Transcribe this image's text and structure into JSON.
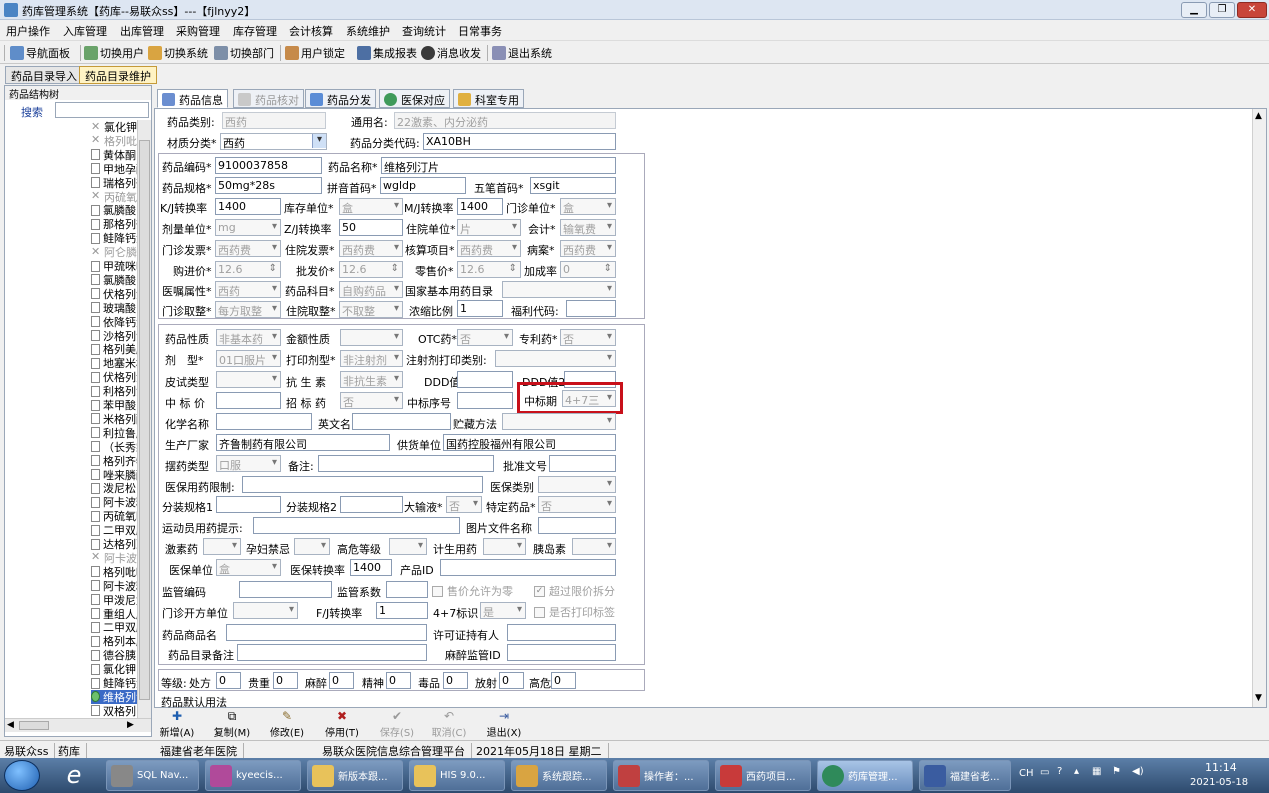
{
  "window": {
    "title": "药库管理系统【药库--易联众ss】---【fjlnyy2】"
  },
  "menu": [
    "用户操作",
    "入库管理",
    "出库管理",
    "采购管理",
    "库存管理",
    "会计核算",
    "系统维护",
    "查询统计",
    "日常事务"
  ],
  "toolbar": [
    "导航面板",
    "切换用户",
    "切换系统",
    "切换部门",
    "用户锁定",
    "集成报表",
    "消息收发",
    "退出系统"
  ],
  "top_tabs": [
    "药品目录导入",
    "药品目录维护"
  ],
  "tree": {
    "title": "药品结构树",
    "search_label": "搜索",
    "nodes": [
      {
        "label": "氯化钾",
        "grey": false,
        "x": true
      },
      {
        "label": "格列吡嗪",
        "grey": true,
        "x": true
      },
      {
        "label": "黄体酮",
        "grey": false,
        "x": false
      },
      {
        "label": "甲地孕酮",
        "grey": false,
        "x": false
      },
      {
        "label": "瑞格列奈",
        "grey": false,
        "x": false
      },
      {
        "label": "丙硫氧嘧啶",
        "grey": true,
        "x": true
      },
      {
        "label": "氯膦酸",
        "grey": false,
        "x": false
      },
      {
        "label": "那格列奈",
        "grey": false,
        "x": false
      },
      {
        "label": "鲑降钙素",
        "grey": false,
        "x": false
      },
      {
        "label": "阿仑膦酸",
        "grey": true,
        "x": true
      },
      {
        "label": "甲巯咪唑",
        "grey": false,
        "x": false
      },
      {
        "label": "氯膦酸",
        "grey": false,
        "x": false
      },
      {
        "label": "伏格列波糖",
        "grey": false,
        "x": false
      },
      {
        "label": "玻璃酸",
        "grey": false,
        "x": false
      },
      {
        "label": "依降钙素",
        "grey": false,
        "x": false
      },
      {
        "label": "沙格列汀",
        "grey": false,
        "x": false
      },
      {
        "label": "格列美脲",
        "grey": false,
        "x": false
      },
      {
        "label": "地塞米松",
        "grey": false,
        "x": false
      },
      {
        "label": "伏格列波糖",
        "grey": false,
        "x": false
      },
      {
        "label": "利格列汀",
        "grey": false,
        "x": false
      },
      {
        "label": "苯甲酸",
        "grey": false,
        "x": false
      },
      {
        "label": "米格列醇",
        "grey": false,
        "x": false
      },
      {
        "label": "利拉鲁肽",
        "grey": false,
        "x": false
      },
      {
        "label": "（长秀霖）",
        "grey": false,
        "x": false
      },
      {
        "label": "格列齐特",
        "grey": false,
        "x": false
      },
      {
        "label": "唑来膦酸",
        "grey": false,
        "x": false
      },
      {
        "label": "泼尼松",
        "grey": false,
        "x": false
      },
      {
        "label": "阿卡波糖",
        "grey": false,
        "x": false
      },
      {
        "label": "丙硫氧嘧啶",
        "grey": false,
        "x": false
      },
      {
        "label": "二甲双胍",
        "grey": false,
        "x": false
      },
      {
        "label": "达格列净",
        "grey": false,
        "x": false
      },
      {
        "label": "阿卡波糖",
        "grey": true,
        "x": true
      },
      {
        "label": "格列吡嗪",
        "grey": false,
        "x": false
      },
      {
        "label": "阿卡波糖",
        "grey": false,
        "x": false
      },
      {
        "label": "甲泼尼龙",
        "grey": false,
        "x": false
      },
      {
        "label": "重组人胰岛素",
        "grey": false,
        "x": false
      },
      {
        "label": "二甲双胍",
        "grey": false,
        "x": false
      },
      {
        "label": "格列本脲",
        "grey": false,
        "x": false
      },
      {
        "label": "德谷胰岛素",
        "grey": false,
        "x": false
      },
      {
        "label": "氯化钾",
        "grey": false,
        "x": false
      },
      {
        "label": "鲑降钙素",
        "grey": false,
        "x": false
      },
      {
        "label": "维格列汀",
        "grey": false,
        "x": false,
        "selected": true
      },
      {
        "label": "双格列",
        "grey": false,
        "x": false
      }
    ]
  },
  "tabs": [
    {
      "label": "药品信息",
      "active": true,
      "disabled": false
    },
    {
      "label": "药品核对",
      "active": false,
      "disabled": true
    },
    {
      "label": "药品分发",
      "active": false,
      "disabled": false
    },
    {
      "label": "医保对应",
      "active": false,
      "disabled": false
    },
    {
      "label": "科室专用",
      "active": false,
      "disabled": false
    }
  ],
  "form": {
    "l_category": "药品类别:",
    "category": "西药",
    "l_generic": "通用名:",
    "generic": "22激素、内分泌药",
    "l_material": "材质分类*",
    "material": "西药",
    "l_classcode": "药品分类代码:",
    "classcode": "XA10BH",
    "l_code": "药品编码*",
    "code": "9100037858",
    "l_name": "药品名称*",
    "name": "维格列汀片",
    "l_spec": "药品规格*",
    "spec": "50mg*28s",
    "l_pinyin": "拼音首码*",
    "pinyin": "wgldp",
    "l_wubi": "五笔首码*",
    "wubi": "xsgit",
    "l_kj": "K/J转换率",
    "kj": "1400",
    "l_stockunit": "库存单位*",
    "stockunit": "盒",
    "l_mj": "M/J转换率",
    "mj": "1400",
    "l_opunit": "门诊单位*",
    "opunit": "盒",
    "l_doseunit": "剂量单位*",
    "doseunit": "mg",
    "l_zj": "Z/J转换率",
    "zj": "50",
    "l_inunit": "住院单位*",
    "inunit": "片",
    "l_acct": "会计*",
    "acct": "输氧费",
    "l_opinv": "门诊发票*",
    "opinv": "西药费",
    "l_ininv": "住院发票*",
    "ininv": "西药费",
    "l_audit": "核算项目*",
    "audit": "西药费",
    "l_case": "病案*",
    "case": "西药费",
    "l_buy": "购进价*",
    "buy": "12.6",
    "l_whole": "批发价*",
    "whole": "12.6",
    "l_retail": "零售价*",
    "retail": "12.6",
    "l_markup": "加成率",
    "markup": "0",
    "l_orderattr": "医嘱属性*",
    "orderattr": "西药",
    "l_subject": "药品科目*",
    "subject": "自购药品",
    "l_essential": "国家基本用药目录",
    "essential": "",
    "l_opround": "门诊取整*",
    "opround": "每方取整",
    "l_inround": "住院取整*",
    "inround": "不取整",
    "l_ratio": "浓缩比例",
    "ratio": "1",
    "l_fukang": "福利代码:",
    "fukang": "",
    "l_nature": "药品性质",
    "nature": "非基本药",
    "l_amount": "金额性质",
    "amount": "",
    "l_otc": "OTC药*",
    "otc": "否",
    "l_patent": "专利药*",
    "patent": "否",
    "l_form": "剂　型*",
    "form_v": "01口服片",
    "l_printform": "打印剂型*",
    "printform": "非注射剂",
    "l_injprint": "注射剂打印类别:",
    "injprint": "",
    "l_skintest": "皮试类型",
    "skintest": "",
    "l_antibiotic": "抗 生 素",
    "antibiotic": "非抗生素",
    "l_ddd": "DDD值",
    "ddd": "",
    "l_ddd2": "DDD值2",
    "ddd2": "",
    "l_bidprice": "中 标 价",
    "bidprice": "",
    "l_bidmed": "招 标 药",
    "bidmed": "否",
    "l_bidno": "中标序号",
    "bidno": "",
    "l_bidperiod": "中标期",
    "bidperiod": "4+7三",
    "l_chem": "化学名称",
    "chem": "",
    "l_en": "英文名",
    "en": "",
    "l_storage": "贮藏方法",
    "storage": "",
    "l_maker": "生产厂家",
    "maker": "齐鲁制药有限公司",
    "l_supplier": "供货单位",
    "supplier": "国药控股福州有限公司",
    "l_display": "摆药类型",
    "display": "口服",
    "l_note": "备注:",
    "note": "",
    "l_approval": "批准文号",
    "approval": "",
    "l_insurlimit": "医保用药限制:",
    "insurlimit": "",
    "l_insurcat": "医保类别",
    "insurcat": "",
    "l_pack1": "分装规格1",
    "pack1": "",
    "l_pack2": "分装规格2",
    "pack2": "",
    "l_infusion": "大输液*",
    "infusion": "否",
    "l_special": "特定药品*",
    "special": "否",
    "l_athlete": "运动员用药提示:",
    "athlete": "",
    "l_image": "图片文件名称",
    "image": "",
    "l_hormone": "激素药",
    "hormone": "",
    "l_preg": "孕妇禁忌",
    "preg": "",
    "l_alert": "高危等级",
    "alert": "",
    "l_family": "计生用药",
    "family": "",
    "l_insulin": "胰岛素",
    "insulin": "",
    "l_insunit": "医保单位",
    "insunit": "盒",
    "l_insrate": "医保转换率",
    "insrate": "1400",
    "l_pid": "产品ID",
    "pid": "",
    "l_supcode": "监管编码",
    "supcode": "",
    "l_supcoef": "监管系数",
    "supcoef": "",
    "c_allowzero": "售价允许为零",
    "c_overlimit": "超过限价拆分",
    "l_opunit2": "门诊开方单位",
    "opunit2": "",
    "l_fj": "F/J转换率",
    "fj": "1",
    "l_flag47": "4+7标识",
    "flag47": "是",
    "c_printlabel": "是否打印标签",
    "l_trade": "药品商品名",
    "trade": "",
    "l_license": "许可证持有人",
    "license": "",
    "l_catnote": "药品目录备注",
    "catnote": "",
    "l_narcid": "麻醉监管ID",
    "narcid": ""
  },
  "levels": {
    "label": "等级:",
    "items": [
      {
        "label": "处方",
        "value": "0"
      },
      {
        "label": "贵重",
        "value": "0"
      },
      {
        "label": "麻醉",
        "value": "0"
      },
      {
        "label": "精神",
        "value": "0"
      },
      {
        "label": "毒品",
        "value": "0"
      },
      {
        "label": "放射",
        "value": "0"
      },
      {
        "label": "高危",
        "value": "0"
      }
    ],
    "default_usage": "药品默认用法"
  },
  "bottom_buttons": [
    {
      "label": "新增(A)",
      "icon": "plus-icon",
      "disabled": false
    },
    {
      "label": "复制(M)",
      "icon": "copy-icon",
      "disabled": false
    },
    {
      "label": "修改(E)",
      "icon": "edit-icon",
      "disabled": false
    },
    {
      "label": "停用(T)",
      "icon": "stop-icon",
      "disabled": false
    },
    {
      "label": "保存(S)",
      "icon": "save-icon",
      "disabled": true
    },
    {
      "label": "取消(C)",
      "icon": "undo-icon",
      "disabled": true
    },
    {
      "label": "退出(X)",
      "icon": "exit-icon",
      "disabled": false
    }
  ],
  "status": [
    "易联众ss",
    "药库",
    "福建省老年医院",
    "易联众医院信息综合管理平台",
    "2021年05月18日 星期二"
  ],
  "taskbar": {
    "items": [
      "SQL Nav...",
      "kyeecis...",
      "新版本跟...",
      "HIS 9.0...",
      "系统跟踪...",
      "操作者：...",
      "西药项目...",
      "药库管理...",
      "福建省老..."
    ],
    "lang": "CH",
    "time": "11:14",
    "date": "2021-05-18"
  },
  "colors": {
    "highlight": "#c8101a",
    "selected": "#3a6ac6"
  }
}
